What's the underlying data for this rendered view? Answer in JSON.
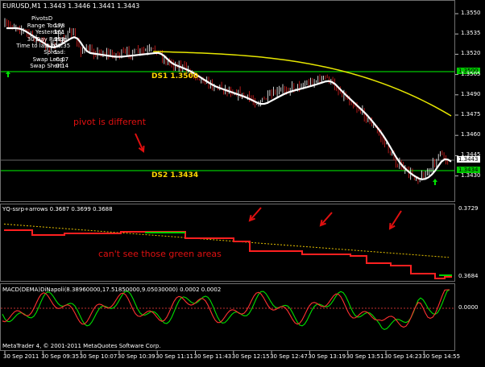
{
  "window": {
    "symbol_title": "EURUSD,M1  1.3443 1.3446 1.3441 1.3443",
    "footer": "MetaTrader 4, © 2001-2011 MetaQuotes Software Corp."
  },
  "pivots": {
    "title": "PivotsD",
    "rows": [
      {
        "label": "Range  Today:",
        "value": "178"
      },
      {
        "label": "Yesterday:",
        "value": "161"
      },
      {
        "label": "30 Day Range:",
        "value": "153"
      },
      {
        "label": "Time to last bar:",
        "value": "00:35"
      },
      {
        "label": "Spread:",
        "value": "1"
      },
      {
        "label": "Swap  Long:",
        "value": "-0.07"
      },
      {
        "label": "Swap  Short:",
        "value": "-0.14"
      }
    ]
  },
  "levels": {
    "ds1": "DS1  1.3500",
    "ds2": "DS2  1.3434",
    "tag_3500": "1.3500",
    "tag_3443": "1.3443",
    "tag_3434": "1.3434"
  },
  "price_axis": [
    "1.3550",
    "1.3535",
    "1.3520",
    "1.3505",
    "1.3490",
    "1.3475",
    "1.3460",
    "1.3445",
    "1.3430"
  ],
  "annotations": {
    "pivot_note": "pivot is different",
    "green_note": "can't see those green areas"
  },
  "indicator1": {
    "title": "YQ-ssrp+arrows 0.3687 0.3699 0.3688",
    "axis": [
      "0.3729",
      "0.3684"
    ]
  },
  "indicator2": {
    "title": "MACD(DEMA)DiNapoli(8.38960000,17.51850000,9.05030000) 0.0002 0.0002",
    "axis": [
      "0.0000"
    ]
  },
  "time_axis": [
    "30 Sep 2011",
    "30 Sep 09:35",
    "30 Sep 10:07",
    "30 Sep 10:39",
    "30 Sep 11:11",
    "30 Sep 11:43",
    "30 Sep 12:15",
    "30 Sep 12:47",
    "30 Sep 13:19",
    "30 Sep 13:51",
    "30 Sep 14:23",
    "30 Sep 14:55"
  ],
  "colors": {
    "grid": "#6e6e6e",
    "level_line": "#00c800",
    "label_yellow": "#ffd700",
    "annotation_red": "#e01010",
    "candle_red": "#e02020",
    "wma_white": "#ffffff",
    "ma_yellow": "#e6e600"
  }
}
